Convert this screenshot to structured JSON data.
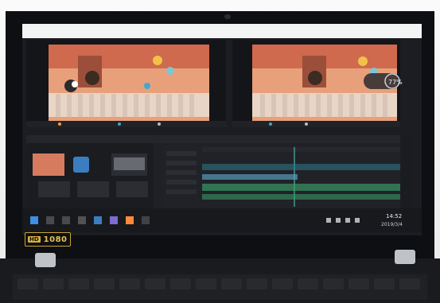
{
  "scene": {
    "premiere_pct": "77%",
    "taskbar_time": "14:52",
    "taskbar_date": "2019/3/4",
    "badge_hd": "HD",
    "badge_resolution": "1080"
  },
  "colors": {
    "screen_bg": "#1b1d22",
    "video_bg": "#e7a07a",
    "timeline_track_blue": "#2f7a8a",
    "timeline_track_green": "#3aa06a",
    "badge_gold": "#d9b13b"
  },
  "icons": [
    "windows-icon",
    "search-icon",
    "taskview-icon",
    "premiere-icon",
    "folder-icon",
    "browser-icon",
    "wifi-icon",
    "volume-icon",
    "battery-icon"
  ]
}
